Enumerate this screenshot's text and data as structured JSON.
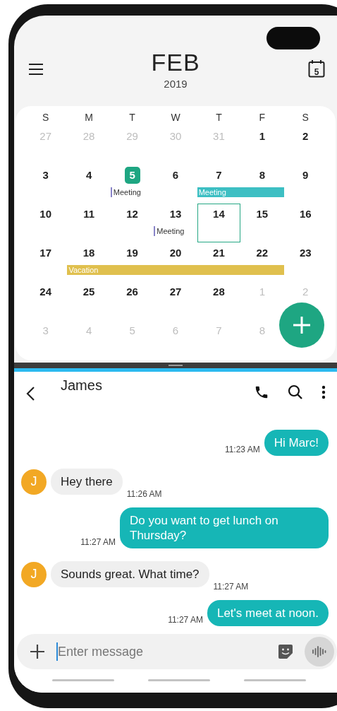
{
  "calendar": {
    "month": "FEB",
    "year": "2019",
    "today_icon": "5",
    "weekdays": [
      "S",
      "M",
      "T",
      "W",
      "T",
      "F",
      "S"
    ],
    "weeks": [
      {
        "days": [
          {
            "day": "27",
            "muted": true,
            "today": false,
            "selected": false
          },
          {
            "day": "28",
            "muted": true,
            "today": false,
            "selected": false
          },
          {
            "day": "29",
            "muted": true,
            "today": false,
            "selected": false
          },
          {
            "day": "30",
            "muted": true,
            "today": false,
            "selected": false
          },
          {
            "day": "31",
            "muted": true,
            "today": false,
            "selected": false
          },
          {
            "day": "1",
            "muted": false,
            "today": false,
            "selected": false
          },
          {
            "day": "2",
            "muted": false,
            "today": false,
            "selected": false
          }
        ]
      },
      {
        "days": [
          {
            "day": "3",
            "muted": false,
            "today": false,
            "selected": false
          },
          {
            "day": "4",
            "muted": false,
            "today": false,
            "selected": false
          },
          {
            "day": "5",
            "muted": false,
            "today": true,
            "selected": false,
            "event": {
              "kind": "tag",
              "title": "Meeting",
              "color": "#8883c8"
            }
          },
          {
            "day": "6",
            "muted": false,
            "today": false,
            "selected": false
          },
          {
            "day": "7",
            "muted": false,
            "today": false,
            "selected": false,
            "event": {
              "kind": "bar",
              "title": "Meeting",
              "color": "#3dbfc3"
            }
          },
          {
            "day": "8",
            "muted": false,
            "today": false,
            "selected": false,
            "event": {
              "kind": "bar",
              "color": "#3dbfc3"
            }
          },
          {
            "day": "9",
            "muted": false,
            "today": false,
            "selected": false
          }
        ]
      },
      {
        "days": [
          {
            "day": "10",
            "muted": false,
            "today": false,
            "selected": false
          },
          {
            "day": "11",
            "muted": false,
            "today": false,
            "selected": false
          },
          {
            "day": "12",
            "muted": false,
            "today": false,
            "selected": false
          },
          {
            "day": "13",
            "muted": false,
            "today": false,
            "selected": false,
            "event": {
              "kind": "tag",
              "title": "Meeting",
              "color": "#8883c8"
            }
          },
          {
            "day": "14",
            "muted": false,
            "today": false,
            "selected": true
          },
          {
            "day": "15",
            "muted": false,
            "today": false,
            "selected": false
          },
          {
            "day": "16",
            "muted": false,
            "today": false,
            "selected": false
          }
        ]
      },
      {
        "days": [
          {
            "day": "17",
            "muted": false,
            "today": false,
            "selected": false
          },
          {
            "day": "18",
            "muted": false,
            "today": false,
            "selected": false,
            "event": {
              "kind": "bar",
              "title": "Vacation",
              "color": "#e0c04e"
            }
          },
          {
            "day": "19",
            "muted": false,
            "today": false,
            "selected": false,
            "event": {
              "kind": "bar",
              "color": "#e0c04e"
            }
          },
          {
            "day": "20",
            "muted": false,
            "today": false,
            "selected": false,
            "event": {
              "kind": "bar",
              "color": "#e0c04e"
            }
          },
          {
            "day": "21",
            "muted": false,
            "today": false,
            "selected": false,
            "event": {
              "kind": "bar",
              "color": "#e0c04e"
            }
          },
          {
            "day": "22",
            "muted": false,
            "today": false,
            "selected": false,
            "event": {
              "kind": "bar",
              "color": "#e0c04e"
            }
          },
          {
            "day": "23",
            "muted": false,
            "today": false,
            "selected": false
          }
        ]
      },
      {
        "days": [
          {
            "day": "24",
            "muted": false,
            "today": false,
            "selected": false
          },
          {
            "day": "25",
            "muted": false,
            "today": false,
            "selected": false
          },
          {
            "day": "26",
            "muted": false,
            "today": false,
            "selected": false
          },
          {
            "day": "27",
            "muted": false,
            "today": false,
            "selected": false
          },
          {
            "day": "28",
            "muted": false,
            "today": false,
            "selected": false
          },
          {
            "day": "1",
            "muted": true,
            "today": false,
            "selected": false
          },
          {
            "day": "2",
            "muted": true,
            "today": false,
            "selected": false
          }
        ]
      },
      {
        "days": [
          {
            "day": "3",
            "muted": true,
            "today": false,
            "selected": false
          },
          {
            "day": "4",
            "muted": true,
            "today": false,
            "selected": false
          },
          {
            "day": "5",
            "muted": true,
            "today": false,
            "selected": false
          },
          {
            "day": "6",
            "muted": true,
            "today": false,
            "selected": false
          },
          {
            "day": "7",
            "muted": true,
            "today": false,
            "selected": false
          },
          {
            "day": "8",
            "muted": true,
            "today": false,
            "selected": false
          }
        ]
      }
    ]
  },
  "chat": {
    "contact": "James",
    "messages": [
      {
        "kind": "sent",
        "text": "Hi Marc!",
        "time": "11:23 AM"
      },
      {
        "kind": "received",
        "avatar": "J",
        "text": "Hey there",
        "time": "11:26 AM"
      },
      {
        "kind": "sent",
        "text": "Do you want to get lunch on Thursday?",
        "time": "11:27 AM"
      },
      {
        "kind": "received",
        "avatar": "J",
        "text": "Sounds great. What time?",
        "time": "11:27 AM"
      },
      {
        "kind": "sent",
        "text": "Let's meet at noon.",
        "time": "11:27 AM"
      }
    ],
    "input": {
      "placeholder": "Enter message"
    }
  }
}
